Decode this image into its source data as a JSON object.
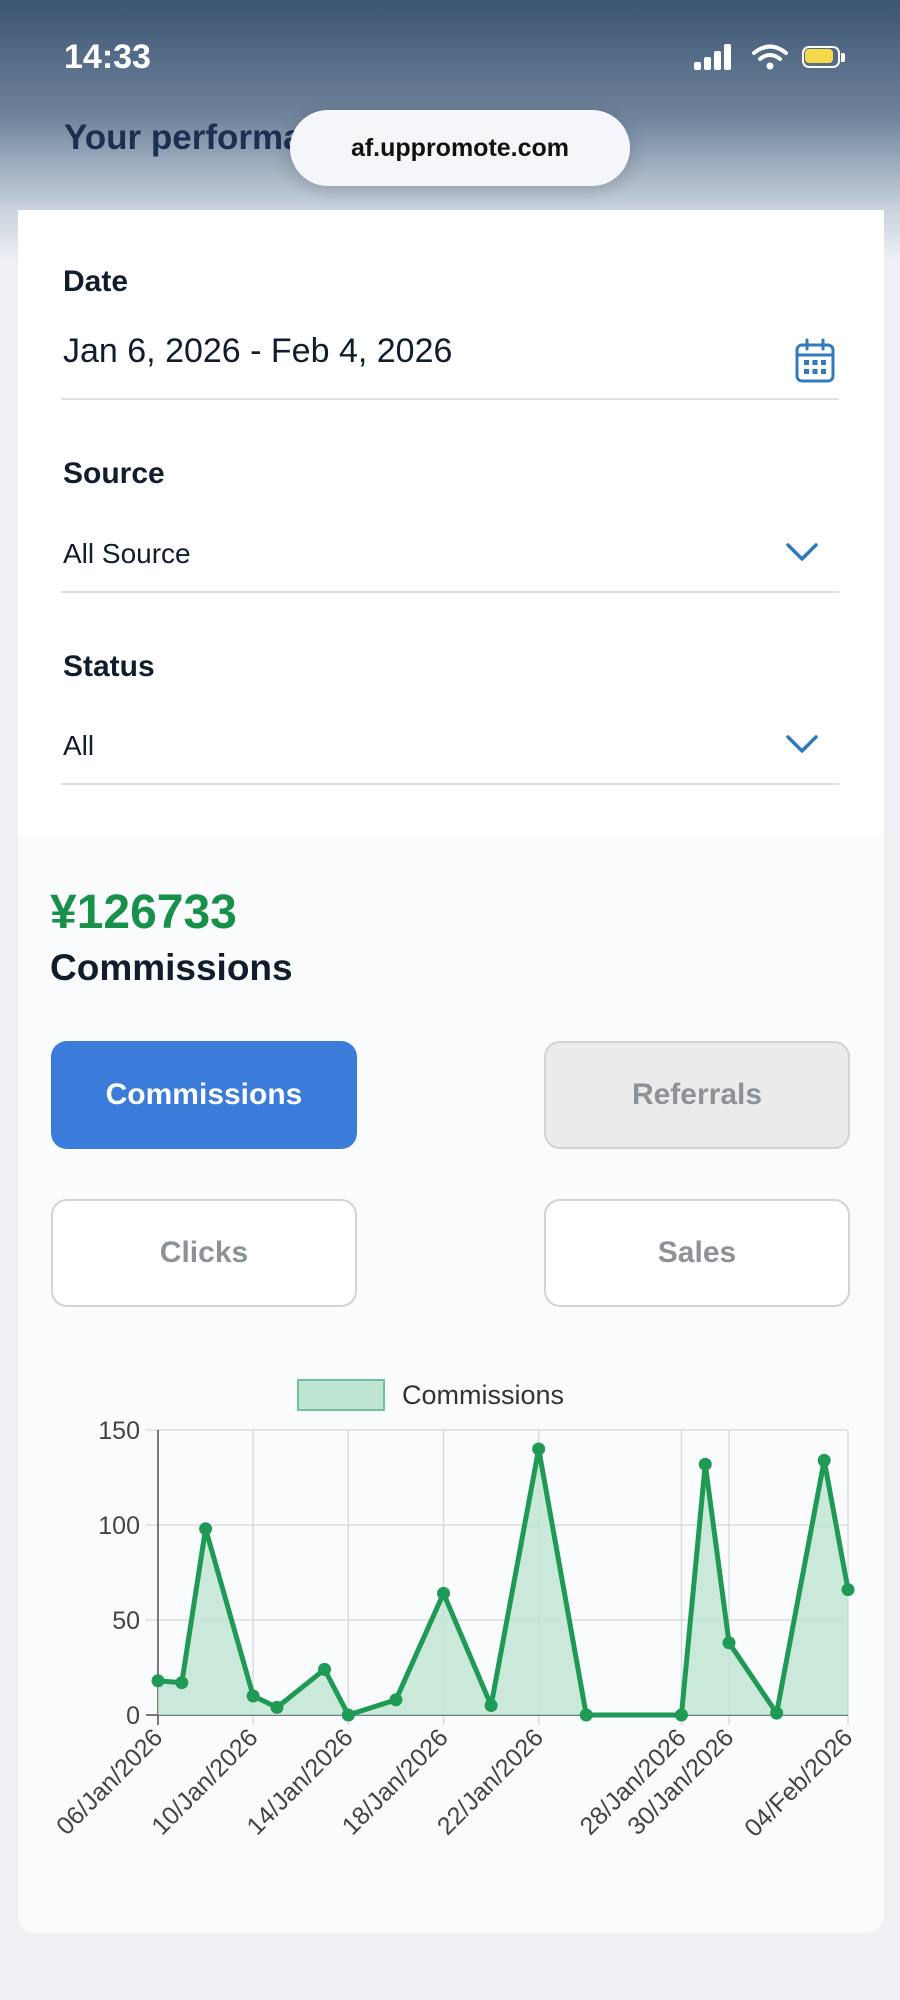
{
  "status_bar": {
    "time": "14:33"
  },
  "header": {
    "title": "Your performance",
    "url": "af.uppromote.com"
  },
  "filters": {
    "date": {
      "label": "Date",
      "value": "Jan 6, 2026 - Feb 4, 2026"
    },
    "source": {
      "label": "Source",
      "value": "All Source"
    },
    "status": {
      "label": "Status",
      "value": "All"
    }
  },
  "summary": {
    "amount": "¥126733",
    "label": "Commissions"
  },
  "tabs": [
    {
      "label": "Commissions",
      "active": true
    },
    {
      "label": "Referrals",
      "active": false
    },
    {
      "label": "Clicks",
      "active": false
    },
    {
      "label": "Sales",
      "active": false
    }
  ],
  "icons": [
    "calendar-icon",
    "chevron-down-icon",
    "signal-icon",
    "wifi-icon",
    "battery-icon"
  ],
  "colors": {
    "accent": "#3b7bd9",
    "positive": "#17914a",
    "series_line": "#1f9a55",
    "series_fill": "#bfe5d2"
  },
  "chart_data": {
    "type": "area",
    "title": "",
    "xlabel": "",
    "ylabel": "",
    "legend": {
      "position": "top-center",
      "entries": [
        "Commissions"
      ]
    },
    "grid": true,
    "ylim": [
      0,
      150
    ],
    "y_ticks": [
      0,
      50,
      100,
      150
    ],
    "x_tick_labels": [
      "06/Jan/2026",
      "10/Jan/2026",
      "14/Jan/2026",
      "18/Jan/2026",
      "22/Jan/2026",
      "28/Jan/2026",
      "30/Jan/2026",
      "04/Feb/2026"
    ],
    "series": [
      {
        "name": "Commissions",
        "points": [
          {
            "x": "06/Jan/2026",
            "y": 18
          },
          {
            "x": "07/Jan/2026",
            "y": 17
          },
          {
            "x": "08/Jan/2026",
            "y": 98
          },
          {
            "x": "10/Jan/2026",
            "y": 10
          },
          {
            "x": "11/Jan/2026",
            "y": 4
          },
          {
            "x": "13/Jan/2026",
            "y": 24
          },
          {
            "x": "14/Jan/2026",
            "y": 0
          },
          {
            "x": "16/Jan/2026",
            "y": 8
          },
          {
            "x": "18/Jan/2026",
            "y": 64
          },
          {
            "x": "20/Jan/2026",
            "y": 5
          },
          {
            "x": "22/Jan/2026",
            "y": 140
          },
          {
            "x": "24/Jan/2026",
            "y": 0
          },
          {
            "x": "28/Jan/2026",
            "y": 0
          },
          {
            "x": "29/Jan/2026",
            "y": 132
          },
          {
            "x": "30/Jan/2026",
            "y": 38
          },
          {
            "x": "01/Feb/2026",
            "y": 1
          },
          {
            "x": "03/Feb/2026",
            "y": 134
          },
          {
            "x": "04/Feb/2026",
            "y": 66
          }
        ]
      }
    ]
  }
}
